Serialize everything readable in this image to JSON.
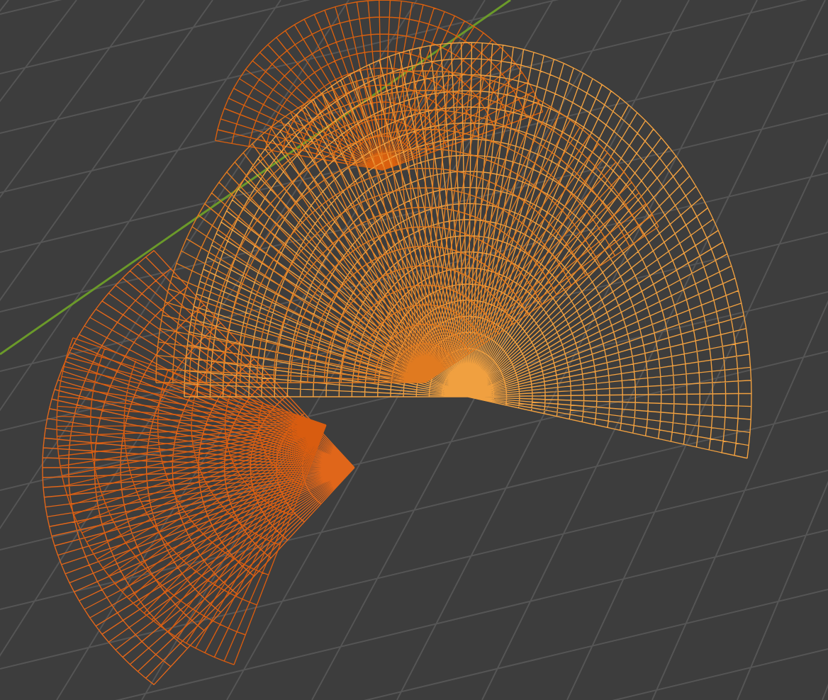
{
  "viewport": {
    "layers": [
      {
        "kind": "grid"
      },
      {
        "kind": "axis"
      },
      {
        "kind": "wireframe"
      }
    ]
  }
}
